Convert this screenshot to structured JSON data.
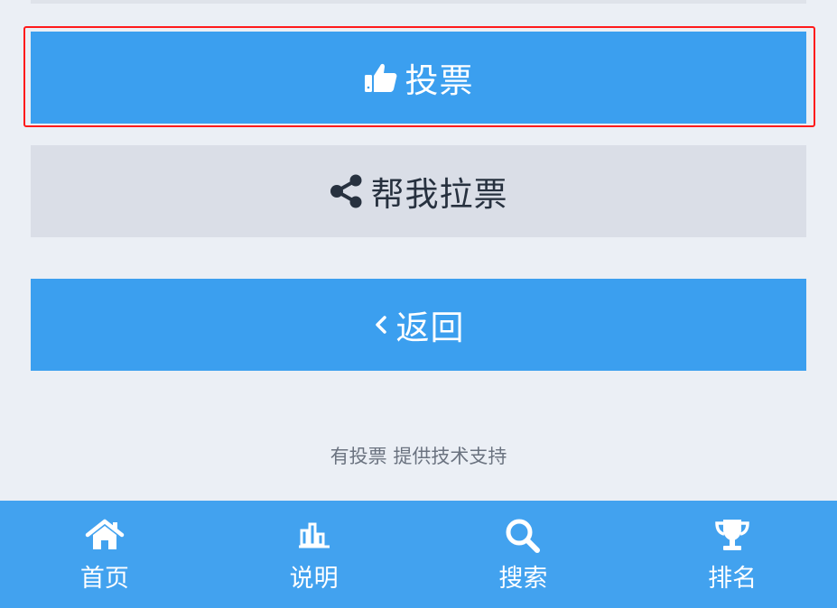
{
  "buttons": {
    "vote_label": "投票",
    "share_label": "帮我拉票",
    "back_label": "返回"
  },
  "footer": {
    "credit": "有投票 提供技术支持"
  },
  "tabbar": {
    "items": [
      {
        "label": "首页",
        "icon": "home-icon"
      },
      {
        "label": "说明",
        "icon": "bar-chart-icon"
      },
      {
        "label": "搜索",
        "icon": "search-icon"
      },
      {
        "label": "排名",
        "icon": "trophy-icon"
      }
    ]
  },
  "colors": {
    "primary": "#3b9fef",
    "secondary": "#dadee7",
    "background": "#ebeff5",
    "highlight": "#ff1a1a",
    "tabbar": "#42a2ef"
  }
}
